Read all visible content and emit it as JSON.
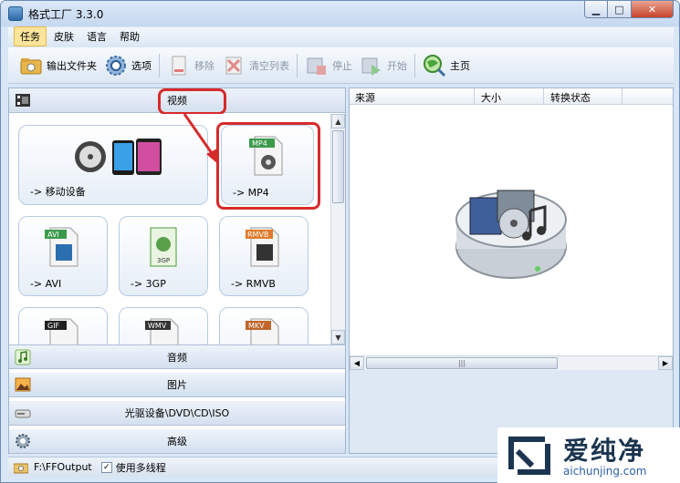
{
  "window": {
    "title": "格式工厂 3.3.0",
    "min": "▁",
    "max": "□",
    "close": "✕"
  },
  "menu": [
    "任务",
    "皮肤",
    "语言",
    "帮助"
  ],
  "toolbar": {
    "output_folder": "输出文件夹",
    "options": "选项",
    "remove": "移除",
    "clear_list": "清空列表",
    "stop": "停止",
    "start": "开始",
    "home": "主页"
  },
  "categories": {
    "video": "视频",
    "audio": "音频",
    "picture": "图片",
    "rom": "光驱设备\\DVD\\CD\\ISO",
    "advanced": "高级"
  },
  "tiles": [
    {
      "label": "-> 移动设备",
      "icon": "mobile-device-icon"
    },
    {
      "label": "-> MP4",
      "icon": "mp4-file-icon",
      "badge": "MP4"
    },
    {
      "label": "-> AVI",
      "icon": "avi-file-icon",
      "badge": "AVI"
    },
    {
      "label": "-> 3GP",
      "icon": "3gp-file-icon",
      "badge": "3GP"
    },
    {
      "label": "-> RMVB",
      "icon": "rmvb-file-icon",
      "badge": "RMVB"
    },
    {
      "label": "",
      "icon": "gif-file-icon",
      "badge": "GIF"
    },
    {
      "label": "",
      "icon": "wmv-file-icon",
      "badge": "WMV"
    },
    {
      "label": "",
      "icon": "mkv-file-icon",
      "badge": "MKV"
    }
  ],
  "task_list": {
    "columns": [
      "来源",
      "大小",
      "转换状态"
    ]
  },
  "status": {
    "output_path": "F:\\FFOutput",
    "multithread_label": "使用多线程",
    "multithread_checked": "✓"
  },
  "watermark": {
    "brand": "爱纯净",
    "url": "aichunjing.com"
  },
  "colors": {
    "accent_red": "#d62b2b",
    "menu_active": "#fbe59a",
    "frame": "#d9e6f5"
  }
}
